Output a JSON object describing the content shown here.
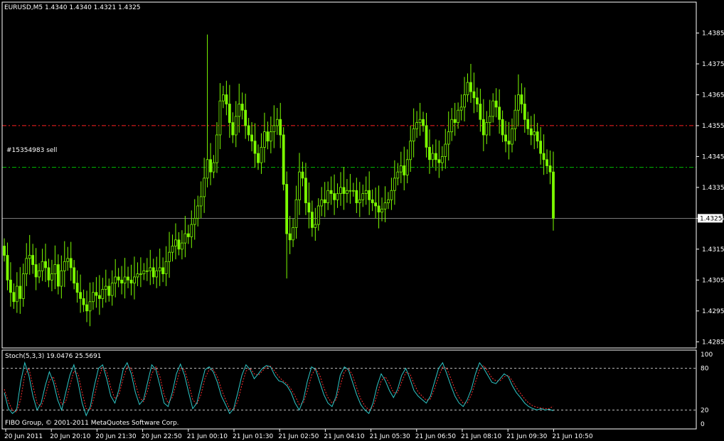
{
  "window": {
    "symbol_header": "EURUSD,M5  1.4340 1.4340 1.4321 1.4325",
    "indicator_header": "Stoch(5,3,3) 19.0476 25.5691",
    "copyright": "FIBO Group, © 2001-2011 MetaQuotes Software Corp.",
    "order_label": "#15354983 sell",
    "current_price": "1.4325"
  },
  "colors": {
    "background": "#000000",
    "frame": "#ffffff",
    "candle": "#7cfc00",
    "stop_line": "#ff2020",
    "order_line": "#00c000",
    "stoch_main": "#2ec7c7",
    "stoch_signal": "#ff3030"
  },
  "price_axis": {
    "min": 1.4283,
    "max": 1.4395,
    "ticks": [
      "1.4385",
      "1.4375",
      "1.4365",
      "1.4355",
      "1.4345",
      "1.4335",
      "1.4325",
      "1.4315",
      "1.4305",
      "1.4295",
      "1.4285"
    ]
  },
  "levels": {
    "stop_level": 1.4355,
    "order_level": 1.43415,
    "current_level": 1.4325
  },
  "stoch_axis": {
    "ticks": [
      "100",
      "80",
      "20",
      "0"
    ],
    "levels": [
      80,
      20
    ]
  },
  "time_axis": {
    "labels": [
      "20 Jun 2011",
      "20 Jun 20:10",
      "20 Jun 21:30",
      "20 Jun 22:50",
      "21 Jun 00:10",
      "21 Jun 01:30",
      "21 Jun 02:50",
      "21 Jun 04:10",
      "21 Jun 05:30",
      "21 Jun 06:50",
      "21 Jun 08:10",
      "21 Jun 09:30",
      "21 Jun 10:50"
    ]
  },
  "chart_data": {
    "type": "candlestick",
    "closes": [
      1.4313,
      1.4305,
      1.4301,
      1.4298,
      1.4303,
      1.4299,
      1.4307,
      1.4312,
      1.4313,
      1.431,
      1.4306,
      1.4308,
      1.4311,
      1.4309,
      1.4305,
      1.4307,
      1.431,
      1.4303,
      1.4308,
      1.4311,
      1.4312,
      1.4309,
      1.4304,
      1.4301,
      1.4299,
      1.4297,
      1.4295,
      1.4298,
      1.4301,
      1.43,
      1.4299,
      1.4302,
      1.4303,
      1.43,
      1.4304,
      1.4306,
      1.4305,
      1.4304,
      1.4306,
      1.4305,
      1.4304,
      1.4306,
      1.4307,
      1.4307,
      1.4308,
      1.4308,
      1.4309,
      1.4306,
      1.4308,
      1.4309,
      1.4307,
      1.4311,
      1.4314,
      1.4316,
      1.4318,
      1.4315,
      1.4317,
      1.432,
      1.4319,
      1.4323,
      1.4325,
      1.4329,
      1.4332,
      1.4338,
      1.4344,
      1.434,
      1.4343,
      1.4352,
      1.4363,
      1.4365,
      1.4362,
      1.4356,
      1.4352,
      1.4358,
      1.4362,
      1.436,
      1.4355,
      1.4352,
      1.435,
      1.4346,
      1.4343,
      1.4348,
      1.4353,
      1.435,
      1.4353,
      1.4355,
      1.4357,
      1.4352,
      1.4336,
      1.432,
      1.4318,
      1.4322,
      1.4331,
      1.434,
      1.4338,
      1.433,
      1.4327,
      1.4322,
      1.4323,
      1.4329,
      1.4331,
      1.433,
      1.4334,
      1.4333,
      1.4331,
      1.4333,
      1.4335,
      1.4333,
      1.4334,
      1.4334,
      1.4334,
      1.433,
      1.4331,
      1.4333,
      1.4334,
      1.4331,
      1.433,
      1.4329,
      1.4327,
      1.4328,
      1.433,
      1.4331,
      1.4334,
      1.4338,
      1.434,
      1.4342,
      1.4339,
      1.4344,
      1.435,
      1.4354,
      1.4356,
      1.4357,
      1.4355,
      1.4348,
      1.4344,
      1.4346,
      1.4344,
      1.4343,
      1.4345,
      1.4349,
      1.4353,
      1.4357,
      1.4356,
      1.436,
      1.4361,
      1.4365,
      1.4369,
      1.4366,
      1.4364,
      1.4362,
      1.4357,
      1.4352,
      1.4356,
      1.4358,
      1.4363,
      1.4361,
      1.4357,
      1.4352,
      1.435,
      1.4349,
      1.4354,
      1.436,
      1.4365,
      1.4362,
      1.4357,
      1.4354,
      1.4352,
      1.4353,
      1.435,
      1.4346,
      1.4344,
      1.4342,
      1.434,
      1.4325
    ],
    "ylim": [
      1.4283,
      1.4395
    ]
  },
  "stoch_data": {
    "main": [
      45,
      22,
      15,
      20,
      60,
      88,
      70,
      40,
      20,
      30,
      55,
      75,
      60,
      35,
      20,
      45,
      70,
      85,
      60,
      30,
      12,
      25,
      55,
      80,
      85,
      65,
      40,
      30,
      50,
      78,
      88,
      72,
      45,
      28,
      35,
      60,
      85,
      78,
      55,
      30,
      25,
      45,
      72,
      86,
      70,
      45,
      22,
      30,
      55,
      78,
      82,
      75,
      60,
      40,
      28,
      15,
      22,
      45,
      70,
      85,
      78,
      65,
      72,
      80,
      84,
      82,
      70,
      62,
      60,
      55,
      45,
      30,
      20,
      35,
      62,
      82,
      78,
      60,
      42,
      30,
      25,
      40,
      70,
      82,
      78,
      60,
      42,
      28,
      20,
      15,
      30,
      55,
      72,
      62,
      48,
      38,
      50,
      70,
      80,
      65,
      48,
      40,
      35,
      30,
      40,
      60,
      80,
      88,
      72,
      55,
      40,
      30,
      25,
      35,
      50,
      72,
      88,
      80,
      70,
      60,
      58,
      65,
      72,
      68,
      55,
      45,
      38,
      30,
      25,
      22,
      20,
      22,
      20,
      21,
      19
    ],
    "signal": [
      50,
      32,
      20,
      17,
      35,
      70,
      80,
      55,
      30,
      25,
      40,
      62,
      68,
      48,
      28,
      32,
      55,
      76,
      72,
      45,
      22,
      20,
      40,
      65,
      82,
      75,
      52,
      36,
      42,
      65,
      82,
      80,
      58,
      38,
      32,
      48,
      72,
      82,
      68,
      42,
      30,
      38,
      58,
      80,
      78,
      58,
      35,
      28,
      42,
      66,
      78,
      78,
      68,
      50,
      35,
      22,
      20,
      33,
      56,
      76,
      80,
      72,
      70,
      76,
      82,
      83,
      76,
      68,
      62,
      58,
      50,
      40,
      28,
      30,
      48,
      70,
      80,
      70,
      52,
      38,
      30,
      35,
      55,
      75,
      80,
      70,
      52,
      36,
      26,
      20,
      24,
      42,
      62,
      68,
      58,
      45,
      45,
      60,
      74,
      72,
      58,
      46,
      40,
      34,
      36,
      50,
      68,
      82,
      80,
      65,
      50,
      38,
      30,
      30,
      42,
      60,
      78,
      84,
      76,
      66,
      62,
      62,
      68,
      70,
      62,
      52,
      44,
      36,
      30,
      26,
      24,
      23,
      22,
      22,
      25.6
    ]
  }
}
